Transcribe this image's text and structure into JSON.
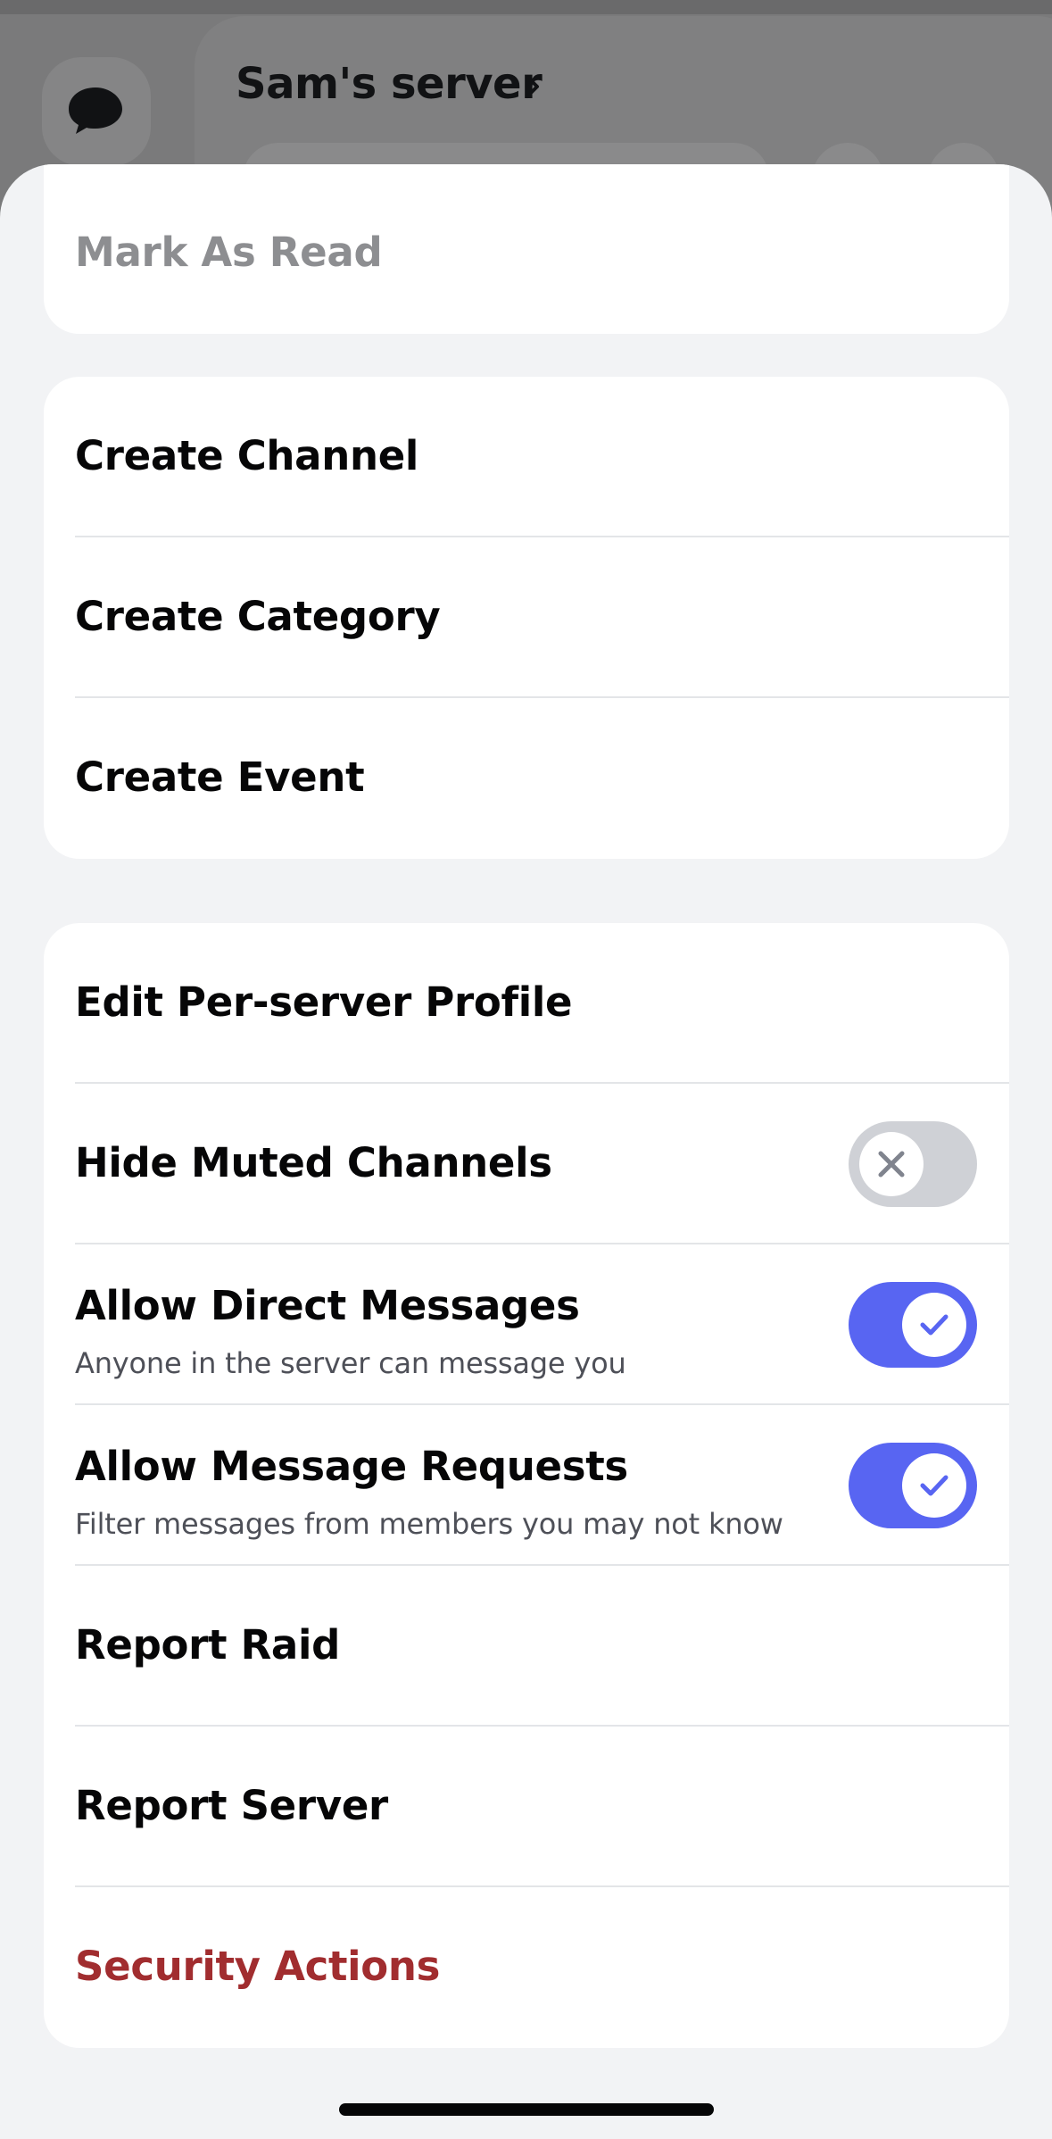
{
  "background": {
    "server_title": "Sam's server",
    "icons": [
      "chat-bubble-icon",
      "chevron-right-icon"
    ]
  },
  "sheet": {
    "card_read": {
      "mark_as_read": "Mark As Read"
    },
    "card_create": {
      "create_channel": "Create Channel",
      "create_category": "Create Category",
      "create_event": "Create Event"
    },
    "card_settings": {
      "edit_profile": "Edit Per-server Profile",
      "hide_muted": {
        "label": "Hide Muted Channels",
        "enabled": false
      },
      "allow_dms": {
        "label": "Allow Direct Messages",
        "sub": "Anyone in the server can message you",
        "enabled": true
      },
      "allow_requests": {
        "label": "Allow Message Requests",
        "sub": "Filter messages from members you may not know",
        "enabled": true
      },
      "report_raid": "Report Raid",
      "report_server": "Report Server",
      "security_actions": "Security Actions"
    }
  },
  "colors": {
    "accent": "#5865f2",
    "danger": "#a12d2f",
    "toggle_off": "#cfd1d6",
    "sheet_bg": "#f2f3f5"
  }
}
